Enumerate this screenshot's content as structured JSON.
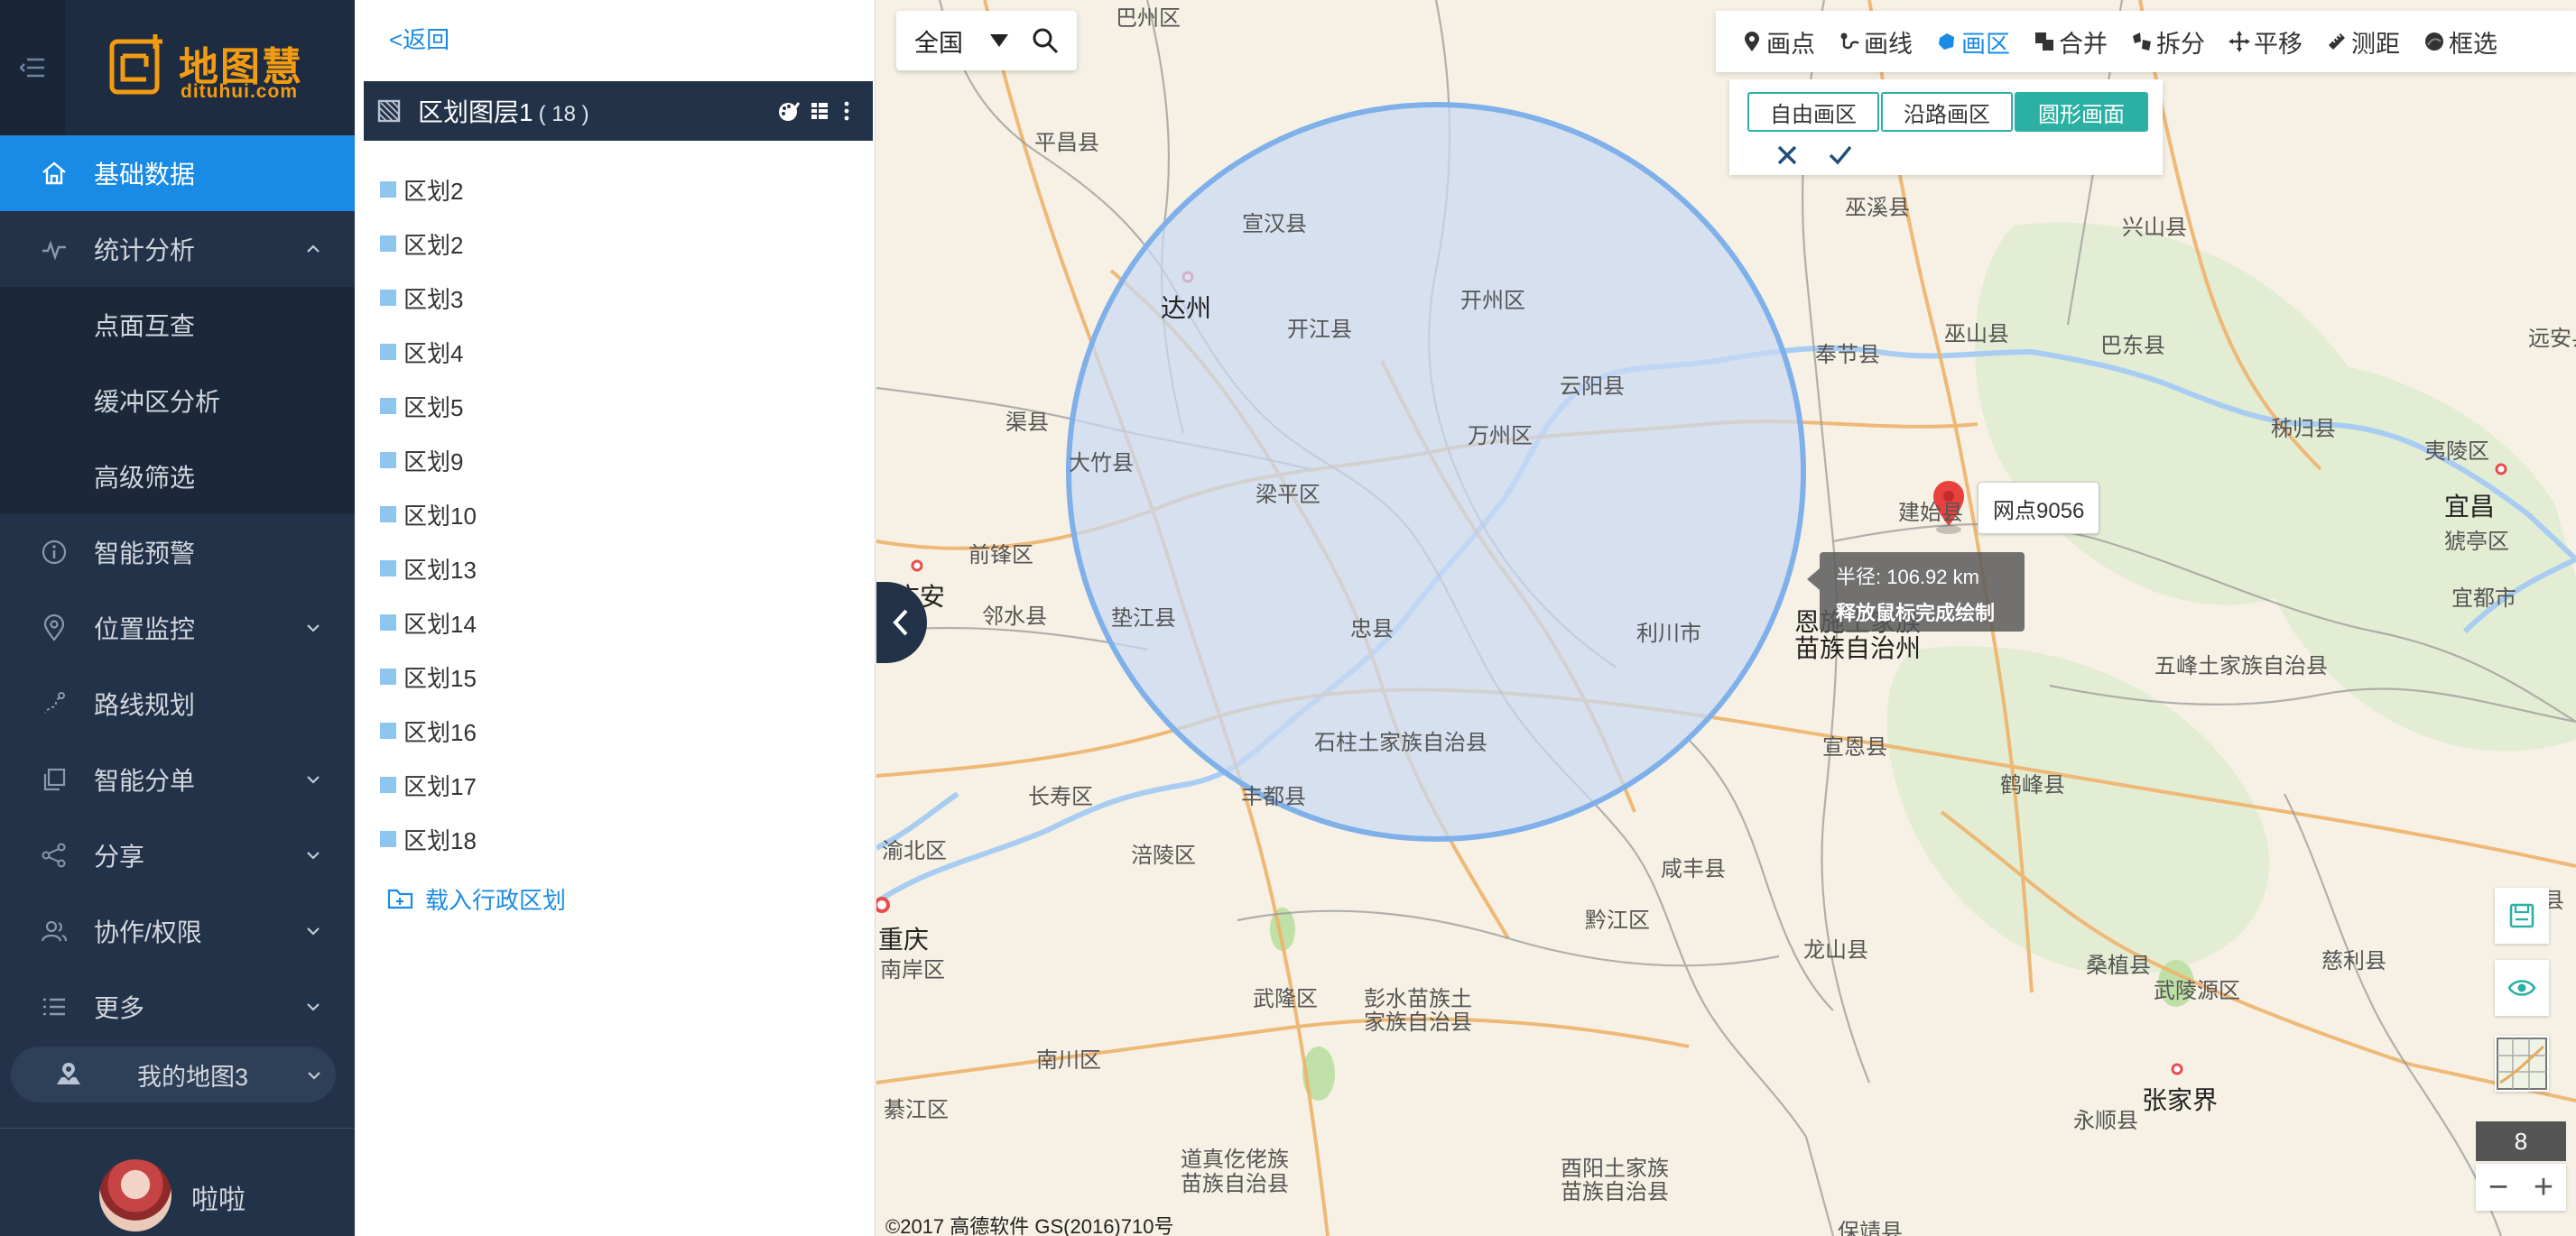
{
  "sidebar": {
    "logo": {
      "brand": "地图慧",
      "domain": "dituhui.com"
    },
    "menu": [
      {
        "label": "基础数据",
        "icon": "home-icon"
      },
      {
        "label": "统计分析",
        "icon": "chart-line-icon"
      },
      {
        "label": "点面互查"
      },
      {
        "label": "缓冲区分析"
      },
      {
        "label": "高级筛选"
      },
      {
        "label": "智能预警",
        "icon": "info-icon"
      },
      {
        "label": "位置监控",
        "icon": "location-icon"
      },
      {
        "label": "路线规划",
        "icon": "route-icon"
      },
      {
        "label": "智能分单",
        "icon": "copy-icon"
      },
      {
        "label": "分享",
        "icon": "share-icon"
      },
      {
        "label": "协作/权限",
        "icon": "users-icon"
      },
      {
        "label": "更多",
        "icon": "list-icon"
      }
    ],
    "my_map": "我的地图3",
    "user": {
      "name": "啦啦"
    },
    "colors": {
      "bg": "#223248",
      "active": "#1a8be4"
    }
  },
  "panel": {
    "back": "<返回",
    "layer": {
      "title": "区划图层1",
      "count": "( 18 )"
    },
    "regions": [
      "区划2",
      "区划2",
      "区划3",
      "区划4",
      "区划5",
      "区划9",
      "区划10",
      "区划13",
      "区划14",
      "区划15",
      "区划16",
      "区划17",
      "区划18"
    ],
    "load_admin": "载入行政区划"
  },
  "map": {
    "search": {
      "region": "全国"
    },
    "toolbar": [
      {
        "label": "画点",
        "icon": "pin-icon"
      },
      {
        "label": "画线",
        "icon": "polyline-icon"
      },
      {
        "label": "画区",
        "icon": "polygon-icon",
        "active": true
      },
      {
        "label": "合并",
        "icon": "merge-icon"
      },
      {
        "label": "拆分",
        "icon": "split-icon"
      },
      {
        "label": "平移",
        "icon": "move-icon"
      },
      {
        "label": "测距",
        "icon": "ruler-icon"
      },
      {
        "label": "框选",
        "icon": "lasso-icon"
      }
    ],
    "draw_modes": [
      {
        "label": "自由画区"
      },
      {
        "label": "沿路画区"
      },
      {
        "label": "圆形画面",
        "active": true
      }
    ],
    "marker": {
      "label": "网点9056"
    },
    "tooltip": {
      "radius": "半径: 106.92 km",
      "hint": "释放鼠标完成绘制"
    },
    "zoom_level": "8",
    "zoom_out": "−",
    "zoom_in": "+",
    "copyright": "©2017 高德软件 GS(2016)710号",
    "cities": [
      {
        "name": "平昌县"
      },
      {
        "name": "宣汉县"
      },
      {
        "name": "达州",
        "big": true
      },
      {
        "name": "开江县"
      },
      {
        "name": "开州区"
      },
      {
        "name": "巫溪县"
      },
      {
        "name": "兴山县"
      },
      {
        "name": "奉节县"
      },
      {
        "name": "巫山县"
      },
      {
        "name": "巴东县"
      },
      {
        "name": "远安县"
      },
      {
        "name": "渠县"
      },
      {
        "name": "云阳县"
      },
      {
        "name": "大竹县"
      },
      {
        "name": "万州区"
      },
      {
        "name": "梁平区"
      },
      {
        "name": "秭归县"
      },
      {
        "name": "夷陵区"
      },
      {
        "name": "宜昌",
        "big": true
      },
      {
        "name": "前锋区"
      },
      {
        "name": "建始县"
      },
      {
        "name": "猇亭区"
      },
      {
        "name": "广安",
        "big": true
      },
      {
        "name": "邻水县"
      },
      {
        "name": "垫江县"
      },
      {
        "name": "忠县"
      },
      {
        "name": "利川市"
      },
      {
        "name": "恩施土家族"
      },
      {
        "name": "苗族自治州"
      },
      {
        "name": "宜都市"
      },
      {
        "name": "五峰土家族自治县"
      },
      {
        "name": "石柱土家族自治县"
      },
      {
        "name": "宣恩县"
      },
      {
        "name": "长寿区"
      },
      {
        "name": "丰都县"
      },
      {
        "name": "鹤峰县"
      },
      {
        "name": "渝北区"
      },
      {
        "name": "涪陵区"
      },
      {
        "name": "咸丰县"
      },
      {
        "name": "石门县"
      },
      {
        "name": "重庆",
        "big": true
      },
      {
        "name": "南岸区"
      },
      {
        "name": "黔江区"
      },
      {
        "name": "龙山县"
      },
      {
        "name": "桑植县"
      },
      {
        "name": "慈利县"
      },
      {
        "name": "武陵源区"
      },
      {
        "name": "武隆区"
      },
      {
        "name": "彭水苗族土"
      },
      {
        "name": "家族自治县"
      },
      {
        "name": "南川区"
      },
      {
        "name": "张家界",
        "big": true
      },
      {
        "name": "綦江区"
      },
      {
        "name": "永顺县"
      },
      {
        "name": "道真仡佬族"
      },
      {
        "name": "苗族自治县"
      },
      {
        "name": "酉阳土家族"
      },
      {
        "name": "苗族自治县"
      },
      {
        "name": "保靖县"
      },
      {
        "name": "巴州区"
      }
    ],
    "colors": {
      "circle_fill": "#c9daf3",
      "circle_stroke": "#7fb0ea",
      "marker": "#e8413e",
      "accent": "#2bb0a3"
    }
  }
}
